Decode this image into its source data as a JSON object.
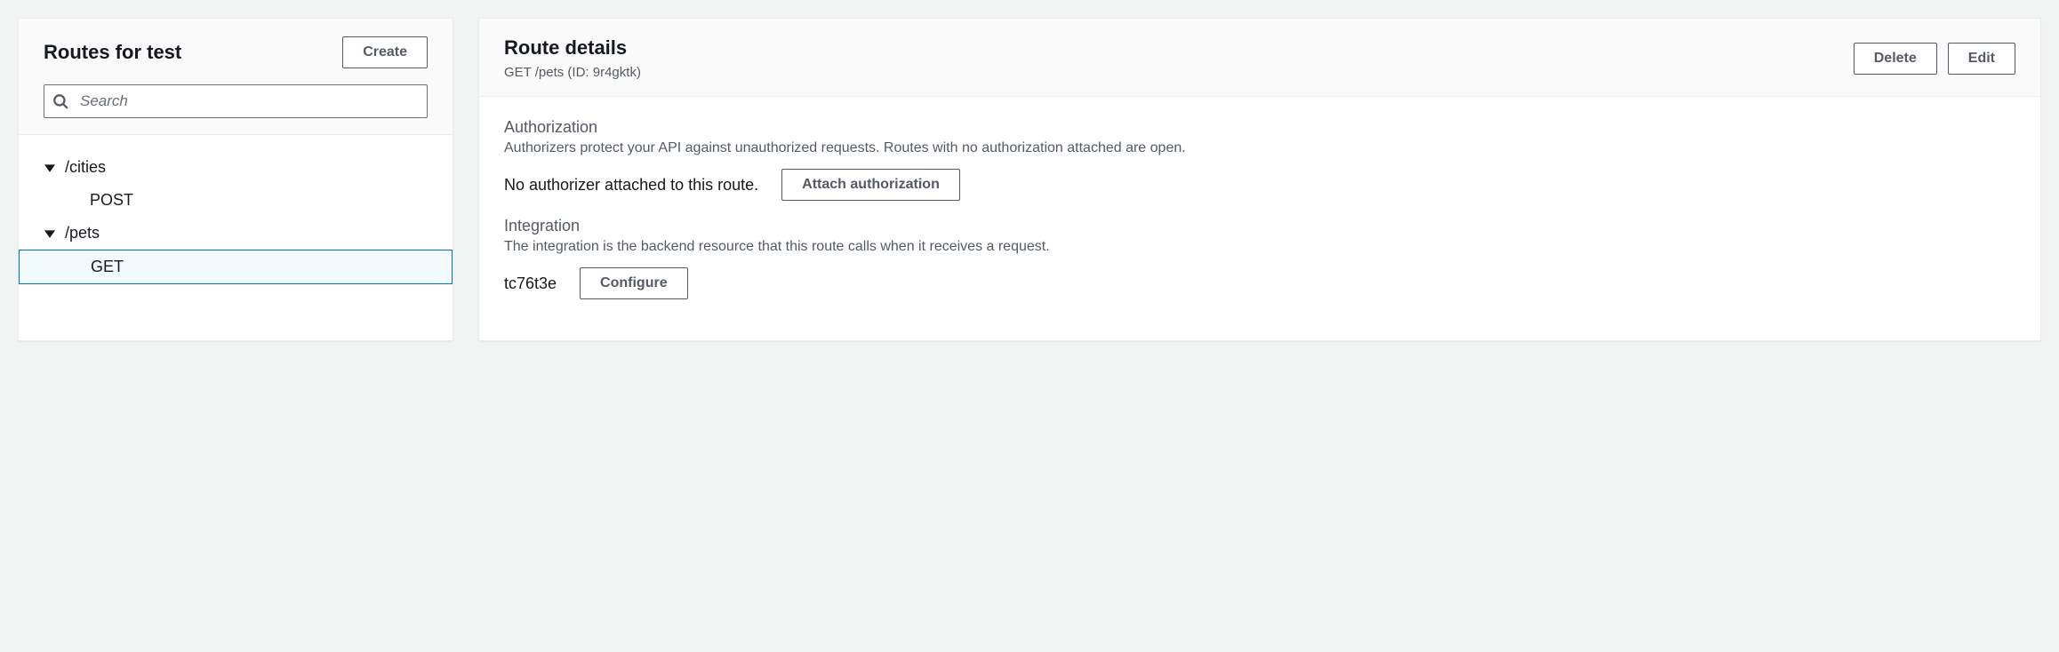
{
  "leftPanel": {
    "title": "Routes for test",
    "createButton": "Create",
    "searchPlaceholder": "Search",
    "routes": [
      {
        "path": "/cities",
        "methods": [
          {
            "name": "POST",
            "selected": false
          }
        ]
      },
      {
        "path": "/pets",
        "methods": [
          {
            "name": "GET",
            "selected": true
          }
        ]
      }
    ]
  },
  "rightPanel": {
    "title": "Route details",
    "subtitle": "GET /pets (ID: 9r4gktk)",
    "deleteButton": "Delete",
    "editButton": "Edit",
    "authorization": {
      "title": "Authorization",
      "description": "Authorizers protect your API against unauthorized requests. Routes with no authorization attached are open.",
      "status": "No authorizer attached to this route.",
      "button": "Attach authorization"
    },
    "integration": {
      "title": "Integration",
      "description": "The integration is the backend resource that this route calls when it receives a request.",
      "id": "tc76t3e",
      "button": "Configure"
    }
  }
}
